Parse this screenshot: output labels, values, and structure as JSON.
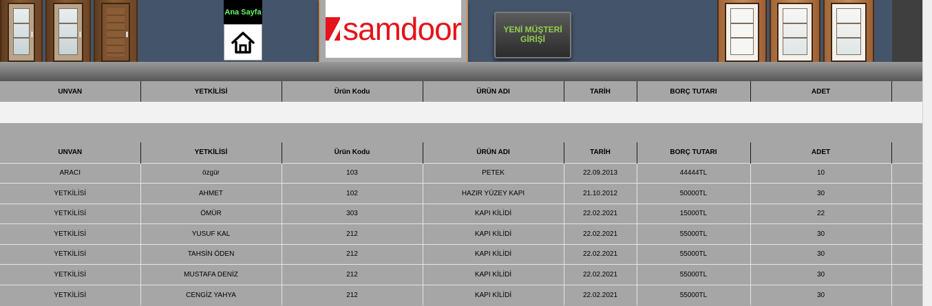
{
  "header": {
    "home_label": "Ana Sayfa",
    "logo_text": "samdoor",
    "new_customer_line1": "YENİ MÜŞTERİ",
    "new_customer_line2": "GİRİŞİ",
    "accent_green": "#66ff66",
    "banner_color": "#44546a",
    "brand_red": "#e3141b"
  },
  "columns": [
    "UNVAN",
    "YETKİLİSİ",
    "Ürün Kodu",
    "ÜRÜN ADI",
    "TARİH",
    "BORÇ TUTARI",
    "ADET",
    ""
  ],
  "rows": [
    {
      "unvan": "ARACI",
      "yetkili": "özgür",
      "kod": "103",
      "urun": "PETEK",
      "tarih": "22.09.2013",
      "borc": "44444TL",
      "adet": "10"
    },
    {
      "unvan": "YETKİLİSİ",
      "yetkili": "AHMET",
      "kod": "102",
      "urun": "HAZIR YÜZEY KAPI",
      "tarih": "21.10.2012",
      "borc": "50000TL",
      "adet": "30"
    },
    {
      "unvan": "YETKİLİSİ",
      "yetkili": "ÖMÜR",
      "kod": "303",
      "urun": "KAPI KİLİDİ",
      "tarih": "22.02.2021",
      "borc": "15000TL",
      "adet": "22"
    },
    {
      "unvan": "YETKİLİSİ",
      "yetkili": "YUSUF KAL",
      "kod": "212",
      "urun": "KAPI KİLİDİ",
      "tarih": "22.02.2021",
      "borc": "55000TL",
      "adet": "30"
    },
    {
      "unvan": "YETKİLİSİ",
      "yetkili": "TAHSİN  ÖDEN",
      "kod": "212",
      "urun": "KAPI KİLİDİ",
      "tarih": "22.02.2021",
      "borc": "55000TL",
      "adet": "30"
    },
    {
      "unvan": "YETKİLİSİ",
      "yetkili": "MUSTAFA DENİZ",
      "kod": "212",
      "urun": "KAPI KİLİDİ",
      "tarih": "22.02.2021",
      "borc": "55000TL",
      "adet": "30"
    },
    {
      "unvan": "YETKİLİSİ",
      "yetkili": "CENGİZ YAHYA",
      "kod": "212",
      "urun": "KAPI KİLİDİ",
      "tarih": "22.02.2021",
      "borc": "55000TL",
      "adet": "30"
    }
  ]
}
